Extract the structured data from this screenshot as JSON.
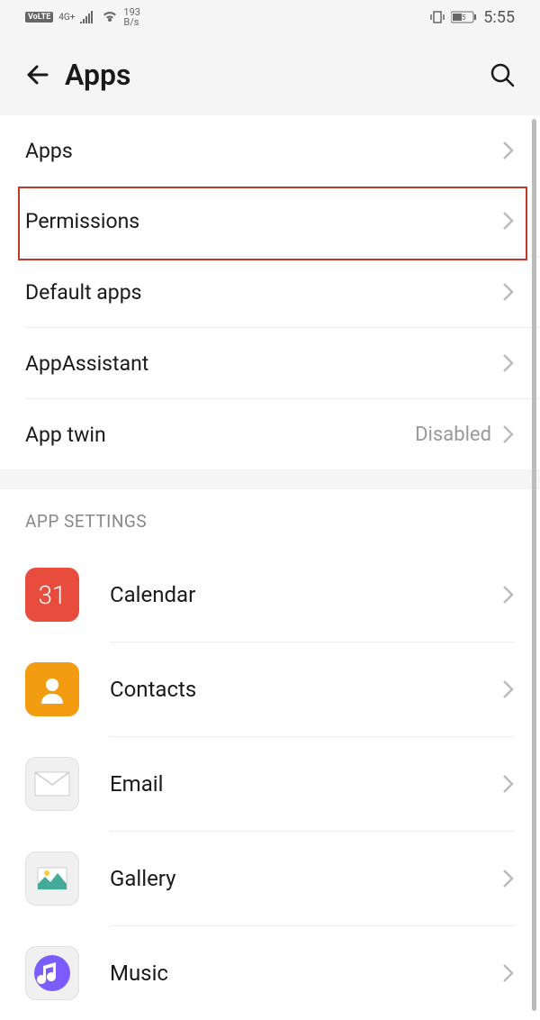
{
  "statusBar": {
    "volte": "VoLTE",
    "network": "4G+",
    "dataRate": "193",
    "dataUnit": "B/s",
    "battery": "45",
    "time": "5:55"
  },
  "header": {
    "title": "Apps"
  },
  "list": {
    "items": [
      {
        "label": "Apps",
        "value": ""
      },
      {
        "label": "Permissions",
        "value": ""
      },
      {
        "label": "Default apps",
        "value": ""
      },
      {
        "label": "AppAssistant",
        "value": ""
      },
      {
        "label": "App twin",
        "value": "Disabled"
      }
    ]
  },
  "sectionHeader": "APP SETTINGS",
  "apps": [
    {
      "label": "Calendar",
      "iconText": "31"
    },
    {
      "label": "Contacts",
      "iconText": ""
    },
    {
      "label": "Email",
      "iconText": ""
    },
    {
      "label": "Gallery",
      "iconText": ""
    },
    {
      "label": "Music",
      "iconText": ""
    }
  ]
}
